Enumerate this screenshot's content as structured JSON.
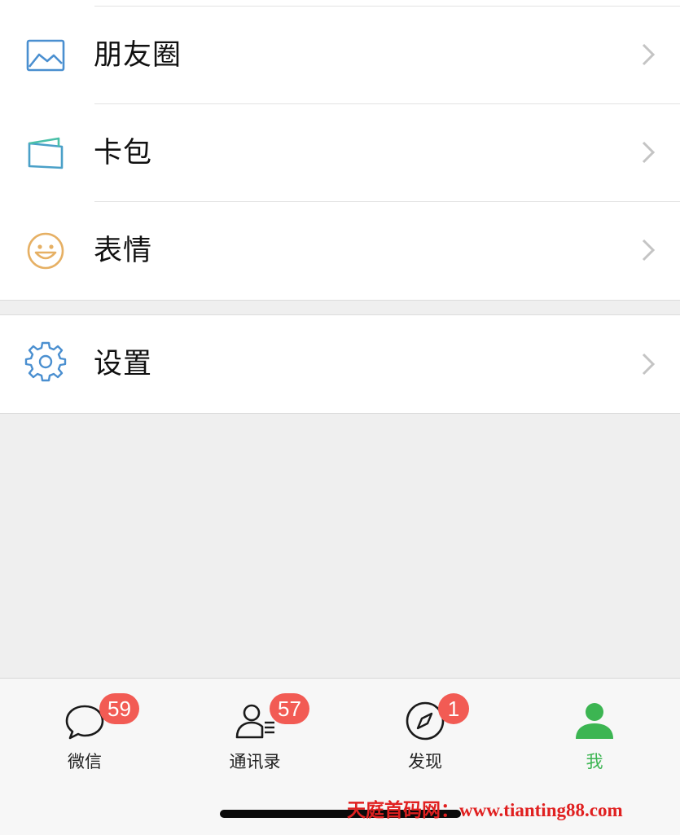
{
  "menu": {
    "group_1": [
      {
        "id": "moments",
        "label": "朋友圈",
        "icon": "moments-image-icon",
        "color": "#4a8fd0"
      },
      {
        "id": "cards",
        "label": "卡包",
        "icon": "card-wallet-icon",
        "color": "#4aa0c8"
      },
      {
        "id": "stickers",
        "label": "表情",
        "icon": "smiley-face-icon",
        "color": "#e6b064"
      }
    ],
    "group_2": [
      {
        "id": "settings",
        "label": "设置",
        "icon": "gear-icon",
        "color": "#4a8fd0"
      }
    ]
  },
  "tabbar": {
    "tabs": [
      {
        "id": "chats",
        "label": "微信",
        "badge": "59",
        "icon": "chat-bubble-icon"
      },
      {
        "id": "contacts",
        "label": "通讯录",
        "badge": "57",
        "icon": "contacts-icon"
      },
      {
        "id": "discover",
        "label": "发现",
        "badge": "1",
        "icon": "compass-icon"
      },
      {
        "id": "me",
        "label": "我",
        "badge": "",
        "icon": "person-icon",
        "active": true
      }
    ],
    "active_color": "#3cb552",
    "badge_color": "#f25b54"
  },
  "watermark": {
    "text": "天庭首码网：www.tianting88.com",
    "color": "#e02020"
  }
}
